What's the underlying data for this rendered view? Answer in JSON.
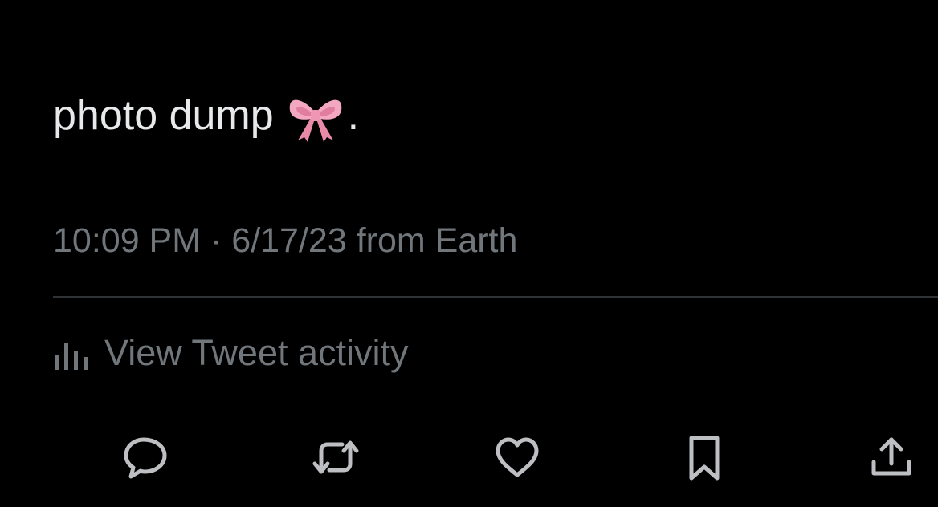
{
  "tweet": {
    "text": "photo dump",
    "emoji": "bow-icon",
    "trailing_punctuation": ".",
    "time": "10:09 PM",
    "separator": " · ",
    "date": "6/17/23",
    "source": " from Earth"
  },
  "activity": {
    "label": "View Tweet activity",
    "icon": "bar-chart-icon"
  },
  "actions": [
    {
      "name": "reply",
      "icon": "comment-icon"
    },
    {
      "name": "retweet",
      "icon": "retweet-icon"
    },
    {
      "name": "like",
      "icon": "heart-icon"
    },
    {
      "name": "bookmark",
      "icon": "bookmark-icon"
    },
    {
      "name": "share",
      "icon": "share-icon"
    }
  ],
  "colors": {
    "background": "#000000",
    "primary_text": "#e7e9ea",
    "secondary_text": "#71767b",
    "divider": "#2f3336",
    "bow": "#f4a7c0"
  }
}
